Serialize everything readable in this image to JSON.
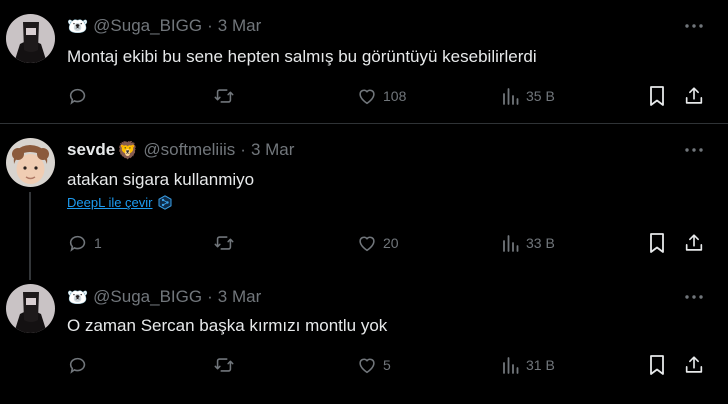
{
  "tweets": [
    {
      "display_name": "",
      "emoji": "🐻‍❄️",
      "handle": "@Suga_BIGG",
      "separator": "·",
      "date": "3 Mar",
      "text": "Montaj ekibi bu sene hepten salmış bu görüntüyü kesebilirlerdi",
      "replies": "",
      "retweets": "",
      "likes": "108",
      "views": "35 B"
    },
    {
      "display_name": "sevde",
      "emoji": "🦁",
      "handle": "@softmeliiis",
      "separator": "·",
      "date": "3 Mar",
      "text": "atakan sigara kullanmiyo",
      "translate": "DeepL ile çevir",
      "replies": "1",
      "retweets": "",
      "likes": "20",
      "views": "33 B"
    },
    {
      "display_name": "",
      "emoji": "🐻‍❄️",
      "handle": "@Suga_BIGG",
      "separator": "·",
      "date": "3 Mar",
      "text": "O zaman Sercan başka kırmızı montlu yok",
      "replies": "",
      "retweets": "",
      "likes": "5",
      "views": "31 B"
    }
  ],
  "colors": {
    "background": "#000000",
    "text": "#e7e9ea",
    "muted": "#71767b",
    "link": "#1d9bf0",
    "divider": "#2f3336"
  }
}
